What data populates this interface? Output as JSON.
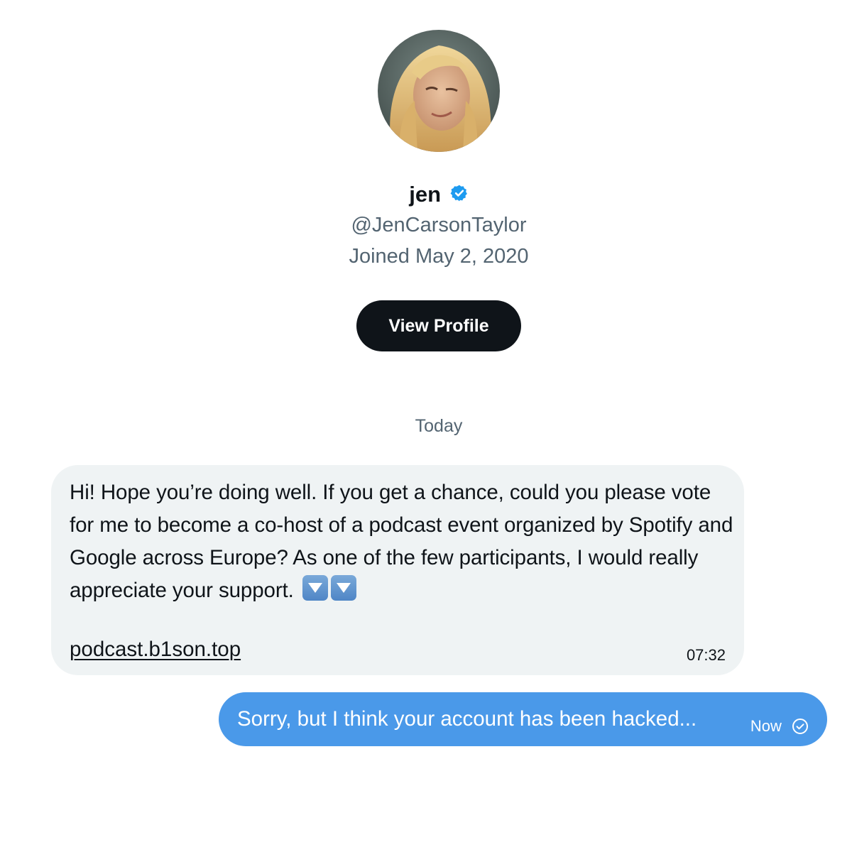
{
  "profile": {
    "name": "jen",
    "verified_icon": "verified-badge-icon",
    "handle": "@JenCarsonTaylor",
    "joined": "Joined May 2, 2020",
    "view_profile_label": "View Profile",
    "accent_color": "#1d9bf0"
  },
  "conversation": {
    "day_separator": "Today",
    "messages": [
      {
        "direction": "incoming",
        "text": "Hi! Hope you’re doing well. If you get a chance, could you please vote for me to become a co-host of a podcast event organized by Spotify and Google across Europe? As one of the few participants, I would really appreciate your support.",
        "emoji": [
          "down-arrow-emoji-icon",
          "down-arrow-emoji-icon"
        ],
        "link": "podcast.b1son.top",
        "time": "07:32",
        "bubble_color": "#eff3f4"
      },
      {
        "direction": "outgoing",
        "text": "Sorry, but I think your account has been hacked...",
        "time": "Now",
        "status_icon": "seen-check-icon",
        "bubble_color": "#4a99e9"
      }
    ]
  }
}
